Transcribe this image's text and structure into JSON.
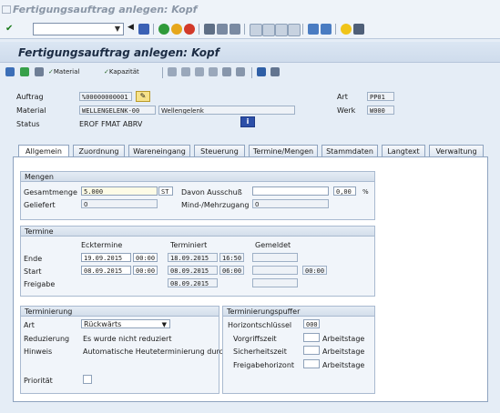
{
  "window": {
    "title": "Fertigungsauftrag anlegen: Kopf"
  },
  "page": {
    "title": "Fertigungsauftrag anlegen: Kopf"
  },
  "toolbar": {
    "command_value": ""
  },
  "app_toolbar": {
    "material_label": "Material",
    "kapazitaet_label": "Kapazität"
  },
  "header": {
    "auftrag_label": "Auftrag",
    "auftrag_value": "%00000000001",
    "material_label": "Material",
    "material_value": "WELLENGELENK-00",
    "material_text": "Wellengelenk",
    "status_label": "Status",
    "status_value": "EROF FMAT ABRV",
    "art_label": "Art",
    "art_value": "PP01",
    "werk_label": "Werk",
    "werk_value": "W000"
  },
  "tabs": [
    "Allgemein",
    "Zuordnung",
    "Wareneingang",
    "Steuerung",
    "Termine/Mengen",
    "Stammdaten",
    "Langtext",
    "Verwaltung"
  ],
  "mengen": {
    "title": "Mengen",
    "gesamtmenge_label": "Gesamtmenge",
    "gesamtmenge_value": "5.000",
    "unit": "ST",
    "ausschuss_label": "Davon Ausschuß",
    "ausschuss_value": "",
    "ausschuss_pct": "0,00",
    "pct_sign": "%",
    "geliefert_label": "Geliefert",
    "geliefert_value": "0",
    "mehrzugang_label": "Mind-/Mehrzugang",
    "mehrzugang_value": "0"
  },
  "termine": {
    "title": "Termine",
    "col_eck": "Ecktermine",
    "col_term": "Terminiert",
    "col_gem": "Gemeldet",
    "ende_label": "Ende",
    "ende_date": "19.09.2015",
    "ende_time": "00:00",
    "ende_term_date": "18.09.2015",
    "ende_term_time": "16:50",
    "start_label": "Start",
    "start_date": "08.09.2015",
    "start_time": "00:00",
    "start_term_date": "08.09.2015",
    "start_term_time": "06:00",
    "start_gem_time": "00:00",
    "freigabe_label": "Freigabe",
    "freigabe_term_date": "08.09.2015"
  },
  "terminierung": {
    "title": "Terminierung",
    "art_label": "Art",
    "art_value": "Rückwärts",
    "reduzierung_label": "Reduzierung",
    "reduzierung_value": "Es wurde nicht reduziert",
    "hinweis_label": "Hinweis",
    "hinweis_value": "Automatische Heuteterminierung durc..",
    "prioritaet_label": "Priorität",
    "prioritaet_value": ""
  },
  "puffer": {
    "title": "Terminierungspuffer",
    "horizont_label": "Horizontschlüssel",
    "horizont_value": "000",
    "vorgriff_label": "Vorgriffszeit",
    "sicherheit_label": "Sicherheitszeit",
    "freigabe_label": "Freigabehorizont",
    "unit": "Arbeitstage"
  },
  "colors": {
    "accent_blue": "#2c4fa8",
    "yellow_button": "#f6e28a",
    "bg": "#dfe8f3"
  }
}
